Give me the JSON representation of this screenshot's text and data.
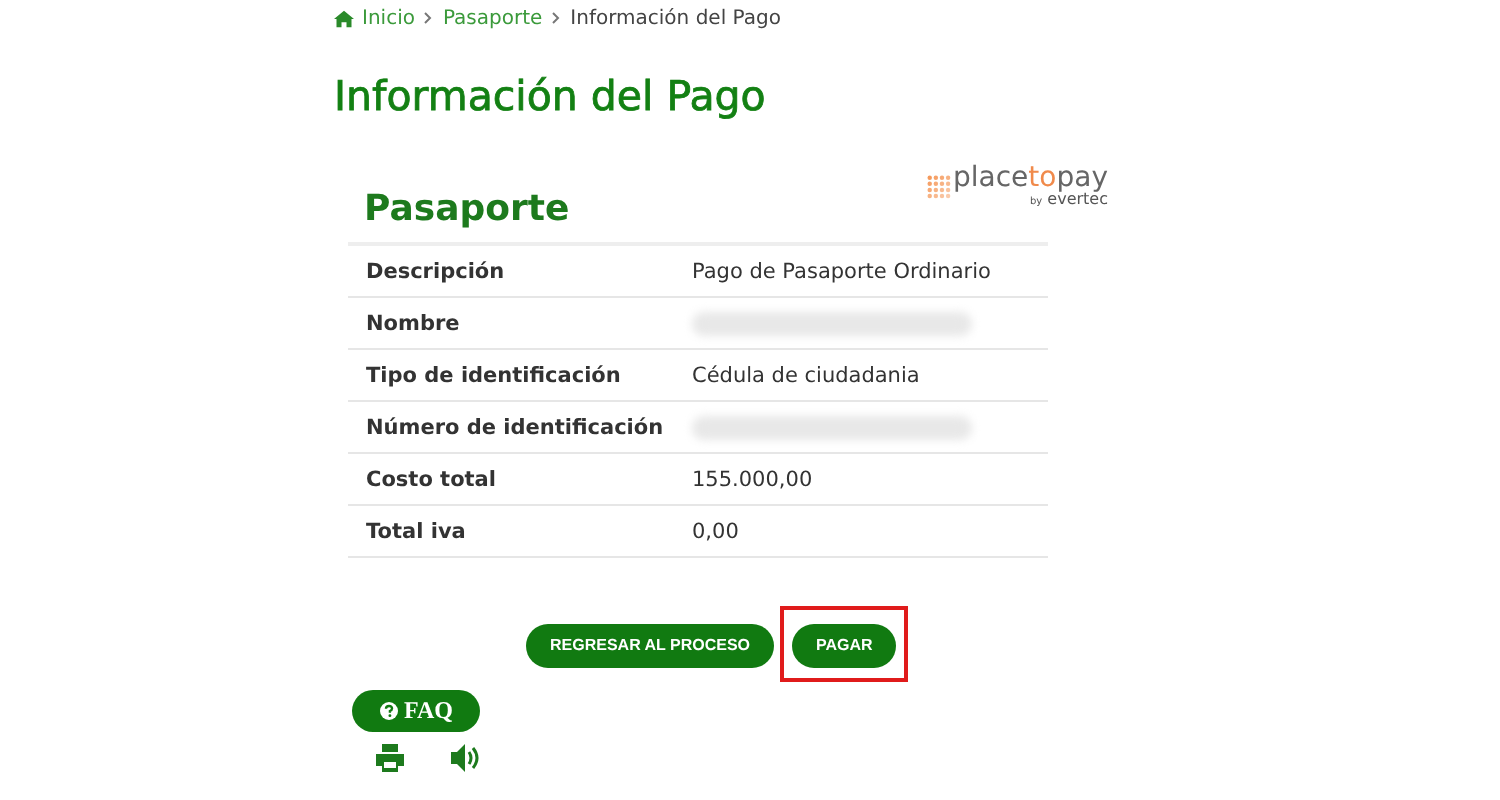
{
  "breadcrumb": [
    {
      "label": "Inicio",
      "kind": "home"
    },
    {
      "label": "Pasaporte",
      "kind": "link"
    },
    {
      "label": "Información del Pago",
      "kind": "current"
    }
  ],
  "title": "Información del Pago",
  "card": {
    "title": "Pasaporte",
    "logo": {
      "brand_a": "place",
      "brand_b": "to",
      "brand_c": "pay",
      "by": "by",
      "maker": "evertec"
    },
    "rows": [
      {
        "label": "Descripción",
        "value": "Pago de Pasaporte Ordinario",
        "redacted": false
      },
      {
        "label": "Nombre",
        "redacted": true
      },
      {
        "label": "Tipo de identificación",
        "value": "Cédula de ciudadania",
        "redacted": false
      },
      {
        "label": "Número de identificación",
        "redacted": true
      },
      {
        "label": "Costo total",
        "value": "155.000,00",
        "redacted": false
      },
      {
        "label": "Total iva",
        "value": "0,00",
        "redacted": false
      }
    ]
  },
  "buttons": [
    {
      "label": "REGRESAR AL PROCESO",
      "highlighted": false
    },
    {
      "label": "PAGAR",
      "highlighted": true
    }
  ],
  "faq": {
    "label": "FAQ"
  }
}
